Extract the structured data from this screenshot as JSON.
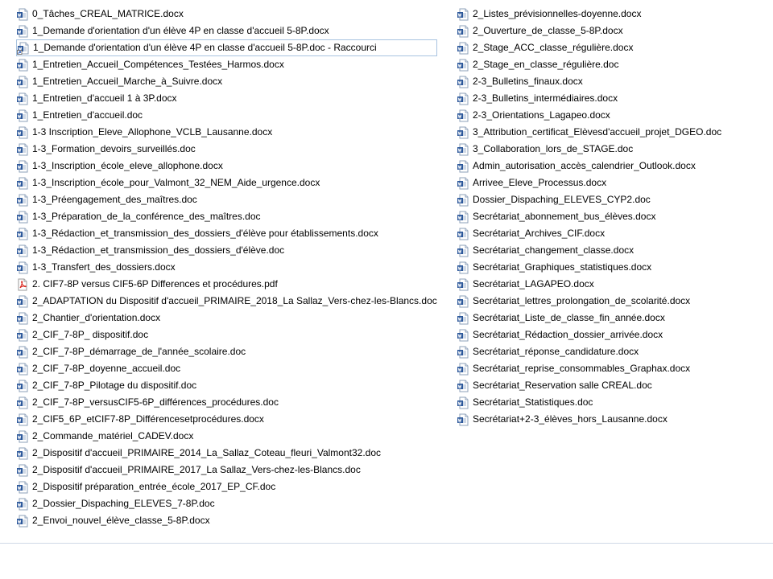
{
  "left_column": [
    {
      "name": "0_Tâches_CREAL_MATRICE.docx",
      "icon": "word-document-icon"
    },
    {
      "name": "1_Demande d'orientation d'un élève 4P en classe d'accueil 5-8P.docx",
      "icon": "word-document-icon"
    },
    {
      "name": "1_Demande d'orientation d'un élève 4P en classe d'accueil 5-8P.doc - Raccourci",
      "icon": "word-shortcut-icon",
      "selected": true
    },
    {
      "name": "1_Entretien_Accueil_Compétences_Testées_Harmos.docx",
      "icon": "word-document-icon"
    },
    {
      "name": "1_Entretien_Accueil_Marche_à_Suivre.docx",
      "icon": "word-document-icon"
    },
    {
      "name": "1_Entretien_d'accueil 1 à 3P.docx",
      "icon": "word-document-icon"
    },
    {
      "name": "1_Entretien_d'accueil.doc",
      "icon": "word-document-icon"
    },
    {
      "name": "1-3 Inscription_Eleve_Allophone_VCLB_Lausanne.docx",
      "icon": "word-document-icon"
    },
    {
      "name": "1-3_Formation_devoirs_surveillés.doc",
      "icon": "word-document-icon"
    },
    {
      "name": "1-3_Inscription_école_eleve_allophone.docx",
      "icon": "word-document-icon"
    },
    {
      "name": "1-3_Inscription_école_pour_Valmont_32_NEM_Aide_urgence.docx",
      "icon": "word-document-icon"
    },
    {
      "name": "1-3_Préengagement_des_maîtres.doc",
      "icon": "word-document-icon"
    },
    {
      "name": "1-3_Préparation_de_la_conférence_des_maîtres.doc",
      "icon": "word-document-icon"
    },
    {
      "name": "1-3_Rédaction_et_transmission_des_dossiers_d'élève pour établissements.docx",
      "icon": "word-document-icon"
    },
    {
      "name": "1-3_Rédaction_et_transmission_des_dossiers_d'élève.doc",
      "icon": "word-document-icon"
    },
    {
      "name": "1-3_Transfert_des_dossiers.docx",
      "icon": "word-document-icon"
    },
    {
      "name": "2. CIF7-8P versus CIF5-6P Differences et procédures.pdf",
      "icon": "pdf-document-icon"
    },
    {
      "name": "2_ADAPTATION du Dispositif d'accueil_PRIMAIRE_2018_La Sallaz_Vers-chez-les-Blancs.doc",
      "icon": "word-document-icon"
    },
    {
      "name": "2_Chantier_d'orientation.docx",
      "icon": "word-document-icon"
    },
    {
      "name": "2_CIF_7-8P_ dispositif.doc",
      "icon": "word-document-icon"
    },
    {
      "name": "2_CIF_7-8P_démarrage_de_l'année_scolaire.doc",
      "icon": "word-document-icon"
    },
    {
      "name": "2_CIF_7-8P_doyenne_accueil.doc",
      "icon": "word-document-icon"
    },
    {
      "name": "2_CIF_7-8P_Pilotage du dispositif.doc",
      "icon": "word-document-icon"
    },
    {
      "name": "2_CIF_7-8P_versusCIF5-6P_différences_procédures.doc",
      "icon": "word-document-icon"
    },
    {
      "name": "2_CIF5_6P_etCIF7-8P_Différencesetprocédures.docx",
      "icon": "word-document-icon"
    },
    {
      "name": "2_Commande_matériel_CADEV.docx",
      "icon": "word-document-icon"
    },
    {
      "name": "2_Dispositif d'accueil_PRIMAIRE_2014_La_Sallaz_Coteau_fleuri_Valmont32.doc",
      "icon": "word-document-icon"
    },
    {
      "name": "2_Dispositif d'accueil_PRIMAIRE_2017_La Sallaz_Vers-chez-les-Blancs.doc",
      "icon": "word-document-icon"
    },
    {
      "name": "2_Dispositif préparation_entrée_école_2017_EP_CF.doc",
      "icon": "word-document-icon"
    },
    {
      "name": "2_Dossier_Dispaching_ELEVES_7-8P.doc",
      "icon": "word-document-icon"
    },
    {
      "name": "2_Envoi_nouvel_élève_classe_5-8P.docx",
      "icon": "word-document-icon"
    }
  ],
  "right_column": [
    {
      "name": "2_Listes_prévisionnelles-doyenne.docx",
      "icon": "word-document-icon"
    },
    {
      "name": "2_Ouverture_de_classe_5-8P.docx",
      "icon": "word-document-icon"
    },
    {
      "name": "2_Stage_ACC_classe_régulière.docx",
      "icon": "word-document-icon"
    },
    {
      "name": "2_Stage_en_classe_régulière.doc",
      "icon": "word-document-icon"
    },
    {
      "name": "2-3_Bulletins_finaux.docx",
      "icon": "word-document-icon"
    },
    {
      "name": "2-3_Bulletins_intermédiaires.docx",
      "icon": "word-document-icon"
    },
    {
      "name": "2-3_Orientations_Lagapeo.docx",
      "icon": "word-document-icon"
    },
    {
      "name": "3_Attribution_certificat_Elèvesd'accueil_projet_DGEO.doc",
      "icon": "word-document-icon"
    },
    {
      "name": "3_Collaboration_lors_de_STAGE.doc",
      "icon": "word-document-icon"
    },
    {
      "name": "Admin_autorisation_accès_calendrier_Outlook.docx",
      "icon": "word-document-icon"
    },
    {
      "name": "Arrivee_Eleve_Processus.docx",
      "icon": "word-document-icon"
    },
    {
      "name": "Dossier_Dispaching_ELEVES_CYP2.doc",
      "icon": "word-document-icon"
    },
    {
      "name": "Secrétariat_abonnement_bus_élèves.docx",
      "icon": "word-document-icon"
    },
    {
      "name": "Secrétariat_Archives_CIF.docx",
      "icon": "word-document-icon"
    },
    {
      "name": "Secrétariat_changement_classe.docx",
      "icon": "word-document-icon"
    },
    {
      "name": "Secrétariat_Graphiques_statistiques.docx",
      "icon": "word-document-icon"
    },
    {
      "name": "Secrétariat_LAGAPEO.docx",
      "icon": "word-document-icon"
    },
    {
      "name": "Secrétariat_lettres_prolongation_de_scolarité.docx",
      "icon": "word-document-icon"
    },
    {
      "name": "Secrétariat_Liste_de_classe_fin_année.docx",
      "icon": "word-document-icon"
    },
    {
      "name": "Secrétariat_Rédaction_dossier_arrivée.docx",
      "icon": "word-document-icon"
    },
    {
      "name": "Secrétariat_réponse_candidature.docx",
      "icon": "word-document-icon"
    },
    {
      "name": "Secrétariat_reprise_consommables_Graphax.docx",
      "icon": "word-document-icon"
    },
    {
      "name": "Secrétariat_Reservation salle CREAL.doc",
      "icon": "word-document-icon"
    },
    {
      "name": "Secrétariat_Statistiques.doc",
      "icon": "word-document-icon"
    },
    {
      "name": "Secrétariat+2-3_élèves_hors_Lausanne.docx",
      "icon": "word-document-icon"
    }
  ],
  "colors": {
    "word_blue": "#2b579a",
    "pdf_red": "#d9251c",
    "selection_border": "#a8c3e0",
    "pane_border": "#cfd8e6"
  }
}
